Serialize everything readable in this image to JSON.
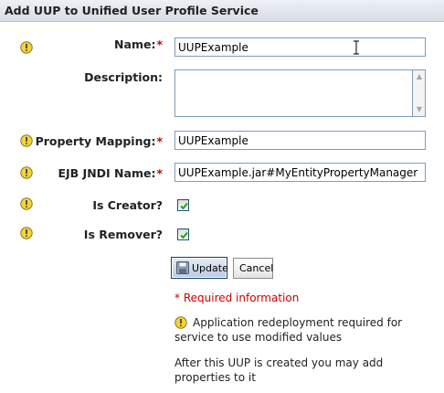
{
  "title": "Add UUP to Unified User Profile Service",
  "fields": {
    "name": {
      "label": "Name:",
      "required_mark": "*",
      "value": "UUPExample"
    },
    "description": {
      "label": "Description:",
      "value": ""
    },
    "property_mapping": {
      "label": "Property Mapping:",
      "required_mark": "*",
      "value": "UUPExample"
    },
    "ejb_jndi_name": {
      "label": "EJB JNDI Name:",
      "required_mark": "*",
      "value": "UUPExample.jar#MyEntityPropertyManager"
    },
    "is_creator": {
      "label": "Is Creator?",
      "checked": true
    },
    "is_remover": {
      "label": "Is Remover?",
      "checked": true
    }
  },
  "buttons": {
    "update": "Update",
    "cancel": "Cancel"
  },
  "notes": {
    "required_mark": "*",
    "required_info": "Required information",
    "redeploy_line1": "Application redeployment required for",
    "redeploy_line2": "service to use modified values",
    "after_line1": "After this UUP is created you may add",
    "after_line2": "properties to it"
  },
  "colors": {
    "required": "#d00000",
    "warning_icon": "#f2d33c",
    "title_bar": "#d7dce6"
  },
  "icons": [
    "warning-icon",
    "floppy-disk-icon",
    "checkmark-icon",
    "text-cursor-icon"
  ]
}
